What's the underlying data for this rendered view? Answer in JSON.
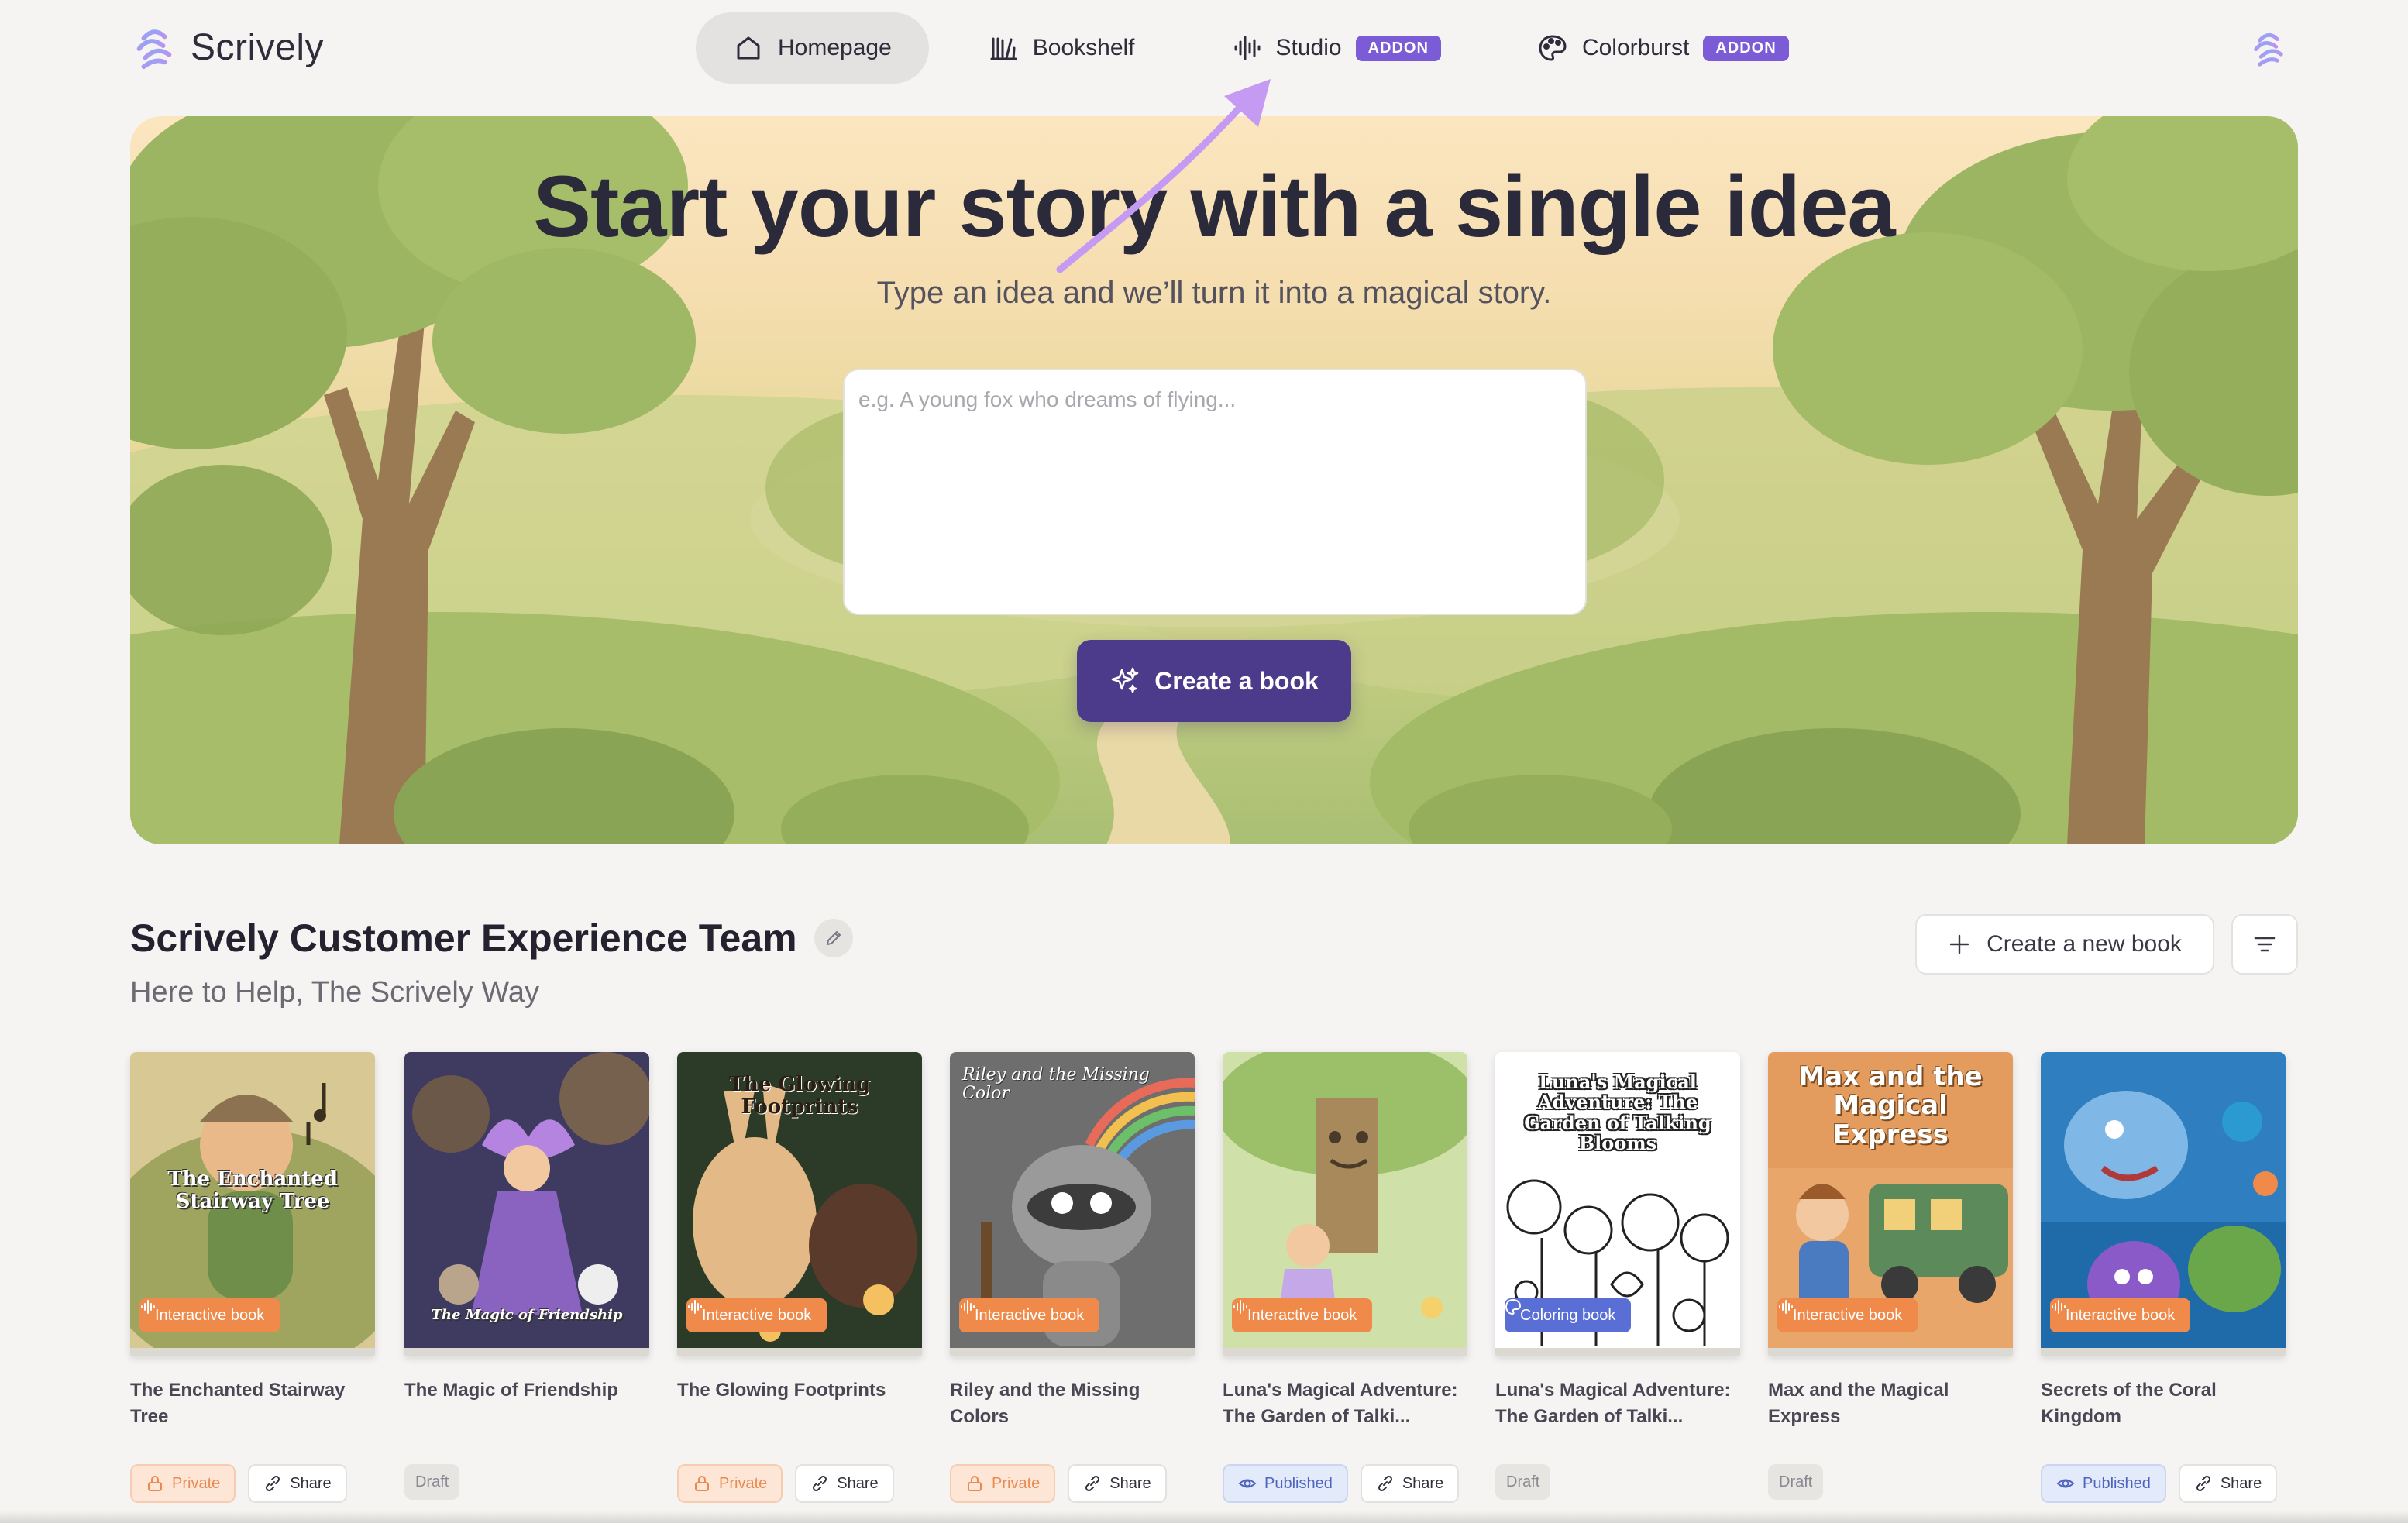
{
  "app": {
    "name": "Scrively"
  },
  "nav": {
    "items": [
      {
        "label": "Homepage",
        "icon": "home-icon",
        "active": true
      },
      {
        "label": "Bookshelf",
        "icon": "bookshelf-icon"
      },
      {
        "label": "Studio",
        "icon": "audio-wave-icon",
        "badge": "ADDON"
      },
      {
        "label": "Colorburst",
        "icon": "palette-icon",
        "badge": "ADDON"
      }
    ]
  },
  "hero": {
    "title": "Start your story with a single idea",
    "subtitle": "Type an idea and we’ll turn it into a magical story.",
    "placeholder": "e.g. A young fox who dreams of flying...",
    "create_label": "Create a book"
  },
  "team": {
    "title": "Scrively Customer Experience Team",
    "subtitle": "Here to Help, The Scrively Way",
    "new_book_label": "Create a new book"
  },
  "colors": {
    "accent": "#4c3a8a",
    "addon": "#7b5cd6",
    "interactive_badge": "#f08a4b",
    "coloring_badge": "#5a6fd6",
    "annotation_arrow": "#c59af2"
  },
  "books": [
    {
      "title": "The Enchanted Stairway Tree",
      "cover_text": "The Enchanted Stairway Tree",
      "type": "Interactive book",
      "status": "Private",
      "share": "Share"
    },
    {
      "title": "The Magic of Friendship",
      "cover_text": "The Magic of Friendship",
      "type": "",
      "status": "Draft",
      "share": ""
    },
    {
      "title": "The Glowing Footprints",
      "cover_text": "The Glowing Footprints",
      "type": "Interactive book",
      "status": "Private",
      "share": "Share"
    },
    {
      "title": "Riley and the Missing Colors",
      "cover_text": "Riley and the Missing Color",
      "type": "Interactive book",
      "status": "Private",
      "share": "Share"
    },
    {
      "title": "Luna's Magical Adventure: The Garden of Talki...",
      "cover_text": "",
      "type": "Interactive book",
      "status": "Published",
      "share": "Share"
    },
    {
      "title": "Luna's Magical Adventure: The Garden of Talki...",
      "cover_text": "Luna's Magical Adventure: The Garden of Talking Blooms",
      "type": "Coloring book",
      "status": "Draft",
      "share": ""
    },
    {
      "title": "Max and the Magical Express",
      "cover_text": "Max and the Magical Express",
      "type": "Interactive book",
      "status": "Draft",
      "share": ""
    },
    {
      "title": "Secrets of the Coral Kingdom",
      "cover_text": "",
      "type": "Interactive book",
      "status": "Published",
      "share": "Share"
    }
  ]
}
